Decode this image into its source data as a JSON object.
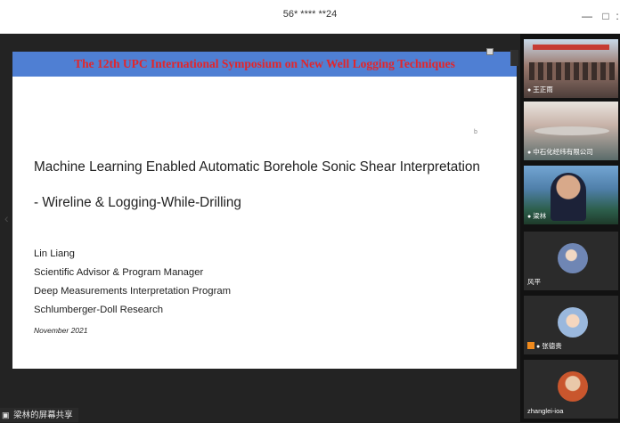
{
  "window": {
    "title": "56* **** **24",
    "minimize_glyph": "—",
    "maximize_glyph": "□",
    "more_glyph": ":"
  },
  "slide": {
    "banner": "The 12th UPC International Symposium on New Well Logging Techniques",
    "dot": "b",
    "title": "Machine Learning Enabled Automatic Borehole Sonic Shear Interpretation",
    "subtitle": "- Wireline & Logging-While-Drilling",
    "author": "Lin Liang",
    "author_role": "Scientific Advisor & Program Manager",
    "author_program": "Deep Measurements Interpretation Program",
    "author_org": "Schlumberger-Doll Research",
    "date": "November 2021"
  },
  "screen_share_label": "梁林的屏幕共享",
  "participants": [
    {
      "name": "王正雨",
      "icon": "mic-icon"
    },
    {
      "name": "中石化经纬有限公司",
      "icon": "mic-icon"
    },
    {
      "name": "梁林",
      "icon": "mic-icon"
    },
    {
      "name": "风平",
      "icon": "none"
    },
    {
      "name": "张德贵",
      "icon": "mic-icon"
    },
    {
      "name": "zhanglei-ioa",
      "icon": "none"
    }
  ],
  "colors": {
    "banner_bg": "#4f7fd3",
    "banner_text": "#e2262b",
    "sidebar_bg": "#121212"
  }
}
